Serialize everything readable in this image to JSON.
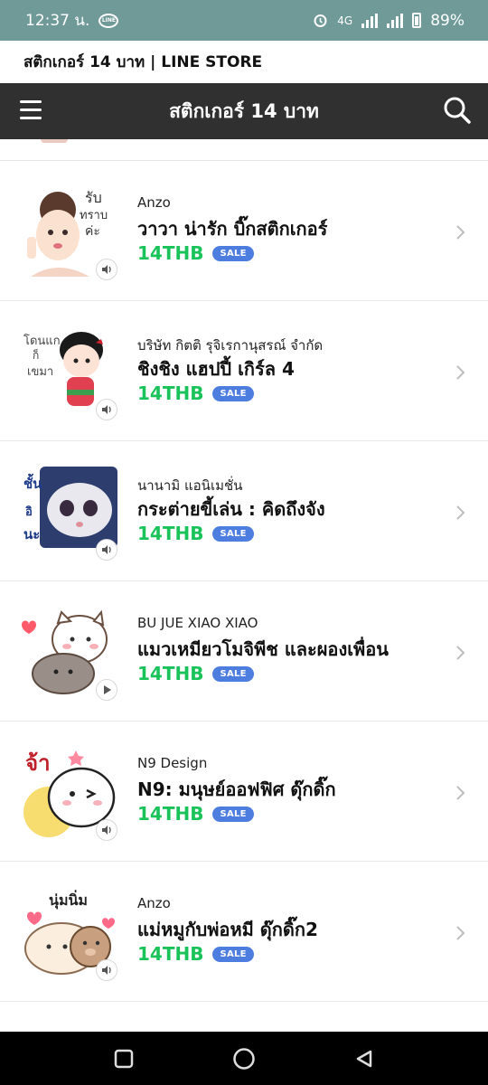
{
  "status_bar": {
    "time": "12:37 น.",
    "network": "4G",
    "battery": "89%"
  },
  "page_title": "สติกเกอร์ 14 บาท | LINE STORE",
  "header": {
    "title": "สติกเกอร์ 14 บาท"
  },
  "sale_label": "SALE",
  "items": [
    {
      "author": "Anzo",
      "name": "วาวา น่ารัก บิ๊กสติกเกอร์",
      "price": "14THB",
      "media": "sound"
    },
    {
      "author": "บริษัท กิตติ รุจิเรกานุสรณ์ จำกัด",
      "name": "ชิงชิง แฮปปี้ เกิร์ล 4",
      "price": "14THB",
      "media": "sound"
    },
    {
      "author": "นานามิ แอนิเมชั่น",
      "name": "กระต่ายขี้เล่น : คิดถึงจัง",
      "price": "14THB",
      "media": "sound"
    },
    {
      "author": "BU JUE XIAO XIAO",
      "name": "แมวเหมียวโมจิพีช และผองเพื่อน",
      "price": "14THB",
      "media": "play"
    },
    {
      "author": "N9 Design",
      "name": "N9: มนุษย์ออฟฟิศ ดุ๊กดิ๊ก",
      "price": "14THB",
      "media": "sound"
    },
    {
      "author": "Anzo",
      "name": "แม่หมูกับพ่อหมี ดุ๊กดิ๊ก2",
      "price": "14THB",
      "media": "sound"
    }
  ],
  "colors": {
    "status_bar": "#6f9a98",
    "header": "#303030",
    "price": "#19c35a",
    "sale_badge": "#4e7de0"
  }
}
